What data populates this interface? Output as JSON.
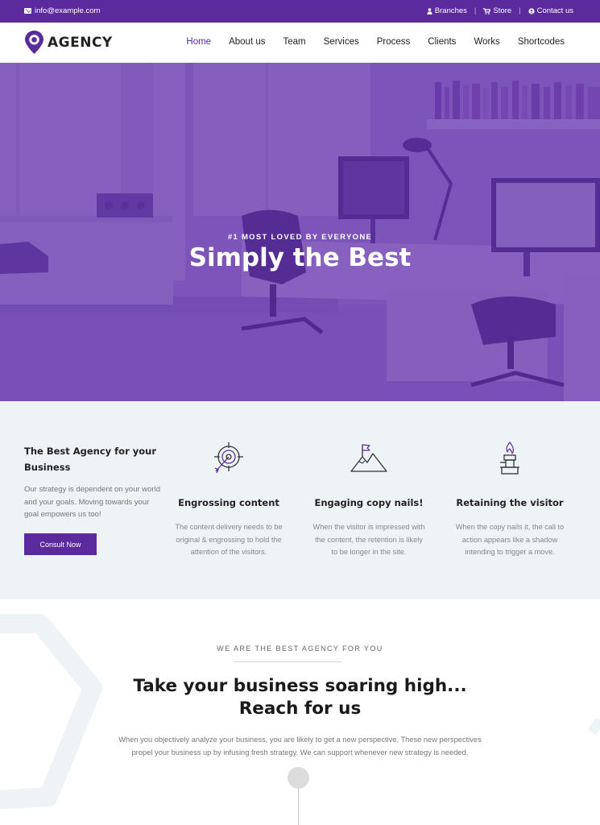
{
  "topbar": {
    "email": "info@example.com",
    "links": [
      "Branches",
      "Store",
      "Contact us"
    ],
    "separator": "|"
  },
  "brand": {
    "name": "AGENCY",
    "color": "#5b2a9c"
  },
  "nav": {
    "items": [
      "Home",
      "About us",
      "Team",
      "Services",
      "Process",
      "Clients",
      "Works",
      "Shortcodes"
    ],
    "active_index": 0
  },
  "hero": {
    "kicker": "#1 MOST LOVED BY EVERYONE",
    "title": "Simply the Best"
  },
  "features": {
    "intro_title": "The Best Agency for your Business",
    "intro_text": "Our strategy is dependent on your world and your goals. Moving towards your goal empowers us too!",
    "cta_label": "Consult Now",
    "items": [
      {
        "icon": "target-arrow-icon",
        "title": "Engrossing content",
        "text": "The content delivery needs to be original & engrossing to hold the attention of the visitors."
      },
      {
        "icon": "mountain-flag-icon",
        "title": "Engaging copy nails!",
        "text": "When the visitor is impressed with the content, the retention is likely to be longer in the site."
      },
      {
        "icon": "trophy-flame-icon",
        "title": "Retaining the visitor",
        "text": "When the copy nails it, the call to action appears like a shadow intending to trigger a move."
      }
    ]
  },
  "about": {
    "subtitle": "WE ARE THE BEST AGENCY FOR YOU",
    "title_line1": "Take your business soaring high...",
    "title_line2": "Reach for us",
    "description": "When you objectively analyze your business, you are likely to get a new perspective. These new perspectives propel your business up by infusing fresh strategy. We can support whenever new strategy is needed."
  },
  "colors": {
    "primary": "#5b2a9c",
    "section_bg": "#eef3f6"
  }
}
